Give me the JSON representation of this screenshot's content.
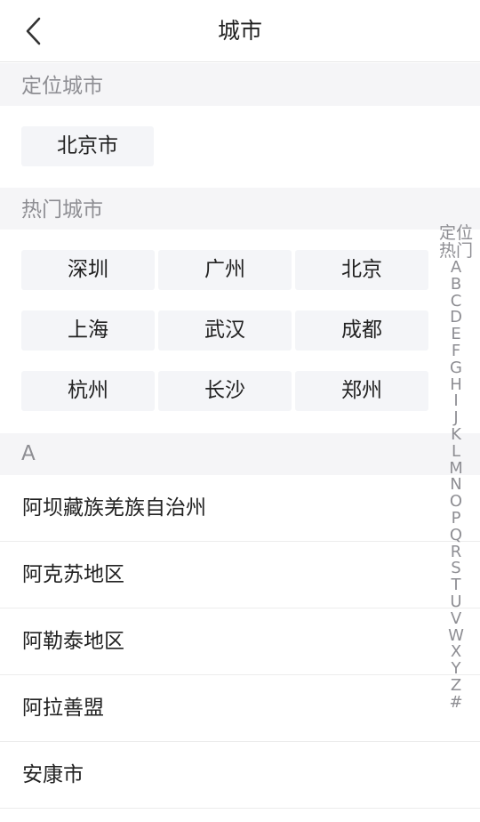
{
  "header": {
    "title": "城市"
  },
  "location_section": {
    "title": "定位城市",
    "city": "北京市"
  },
  "hot_section": {
    "title": "热门城市",
    "cities": [
      "深圳",
      "广州",
      "北京",
      "上海",
      "武汉",
      "成都",
      "杭州",
      "长沙",
      "郑州"
    ]
  },
  "list_section": {
    "letter": "A",
    "items": [
      "阿坝藏族羌族自治州",
      "阿克苏地区",
      "阿勒泰地区",
      "阿拉善盟",
      "安康市"
    ]
  },
  "index": {
    "top_labels": [
      "定位",
      "热门"
    ],
    "letters": [
      "A",
      "B",
      "C",
      "D",
      "E",
      "F",
      "G",
      "H",
      "I",
      "J",
      "K",
      "L",
      "M",
      "N",
      "O",
      "P",
      "Q",
      "R",
      "S",
      "T",
      "U",
      "V",
      "W",
      "X",
      "Y",
      "Z",
      "#"
    ]
  }
}
